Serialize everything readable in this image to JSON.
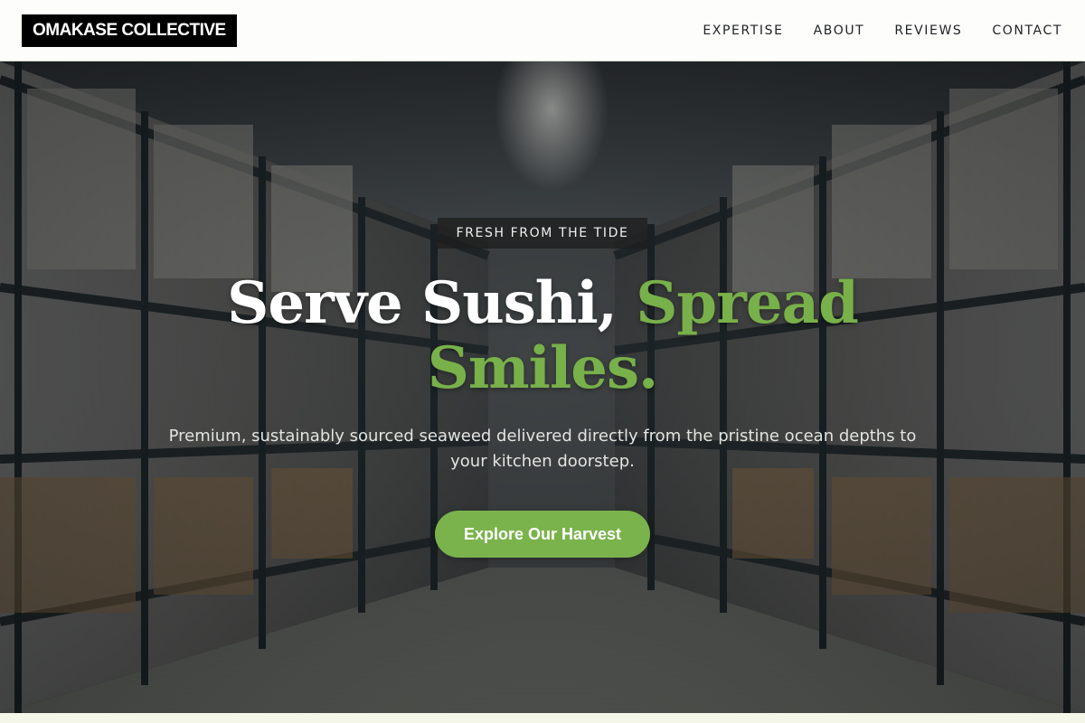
{
  "header": {
    "logo": "OMAKASE COLLECTIVE",
    "nav": [
      {
        "label": "EXPERTISE"
      },
      {
        "label": "ABOUT"
      },
      {
        "label": "REVIEWS"
      },
      {
        "label": "CONTACT"
      }
    ]
  },
  "hero": {
    "eyebrow": "FRESH FROM THE TIDE",
    "headline_main": "Serve Sushi, ",
    "headline_accent": "Spread Smiles.",
    "subtitle": "Premium, sustainably sourced seaweed delivered directly from the pristine ocean depths to your kitchen doorstep.",
    "cta_label": "Explore Our Harvest",
    "background": "warehouse-aisle-photo"
  },
  "colors": {
    "accent": "#78b04a",
    "header_bg": "#fdfdfb",
    "logo_bg": "#000000",
    "bottom_strip": "#f4f7e8"
  }
}
